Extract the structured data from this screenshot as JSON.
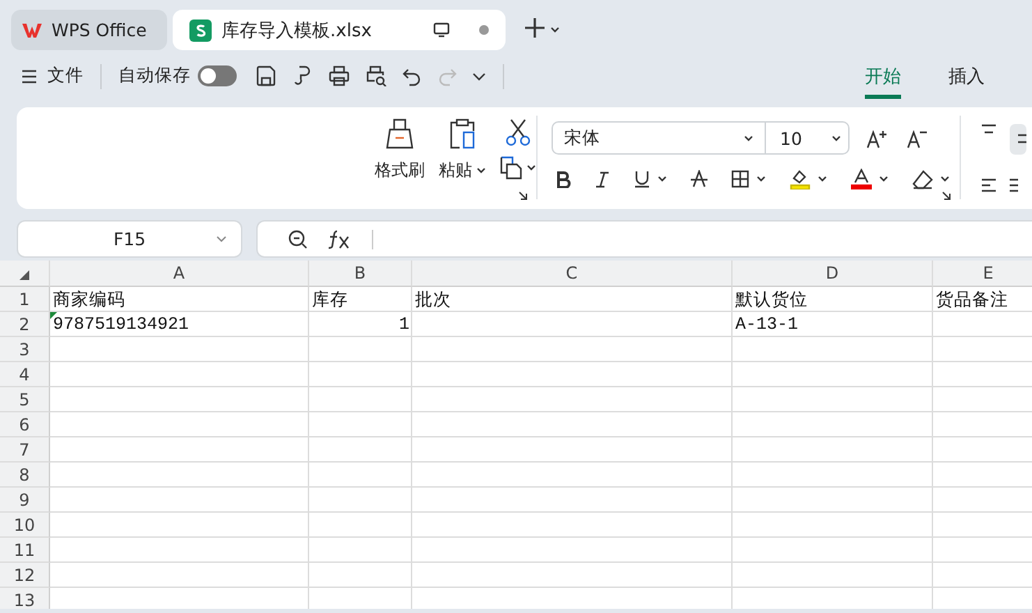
{
  "app_tabs": [
    {
      "kind": "home",
      "label": "WPS Office",
      "selected": false
    },
    {
      "kind": "sheet",
      "label": "库存导入模板.xlsx",
      "selected": true
    }
  ],
  "toolbar": {
    "file_menu": "文件",
    "autosave": {
      "label": "自动保存",
      "on": false
    }
  },
  "ribbon_tabs": [
    {
      "label": "开始",
      "selected": true
    },
    {
      "label": "插入",
      "selected": false
    }
  ],
  "ribbon": {
    "format_painter": "格式刷",
    "paste": "粘贴",
    "font_name": "宋体",
    "font_size": "10"
  },
  "formula_bar": {
    "cell_ref": "F15"
  },
  "sheet": {
    "columns": [
      "A",
      "B",
      "C",
      "D",
      "E"
    ],
    "rows": [
      {
        "header": "1",
        "cells": [
          {
            "text": "商家编码",
            "kind": "text",
            "flagged": false
          },
          {
            "text": "库存",
            "kind": "text",
            "flagged": false
          },
          {
            "text": "批次",
            "kind": "text",
            "flagged": false
          },
          {
            "text": "默认货位",
            "kind": "text",
            "flagged": false
          },
          {
            "text": "货品备注",
            "kind": "text",
            "flagged": false
          }
        ]
      },
      {
        "header": "2",
        "cells": [
          {
            "text": "9787519134921",
            "kind": "text",
            "flagged": true
          },
          {
            "text": "1",
            "kind": "number",
            "flagged": false
          },
          {
            "kind": "empty"
          },
          {
            "text": "A-13-1",
            "kind": "text",
            "flagged": false
          }
        ]
      },
      {
        "header": "3",
        "cells": []
      },
      {
        "header": "4",
        "cells": []
      },
      {
        "header": "5",
        "cells": []
      },
      {
        "header": "6",
        "cells": []
      },
      {
        "header": "7",
        "cells": []
      },
      {
        "header": "8",
        "cells": []
      },
      {
        "header": "9",
        "cells": []
      },
      {
        "header": "10",
        "cells": []
      },
      {
        "header": "11",
        "cells": []
      },
      {
        "header": "12",
        "cells": []
      },
      {
        "header": "13",
        "cells": []
      }
    ]
  }
}
